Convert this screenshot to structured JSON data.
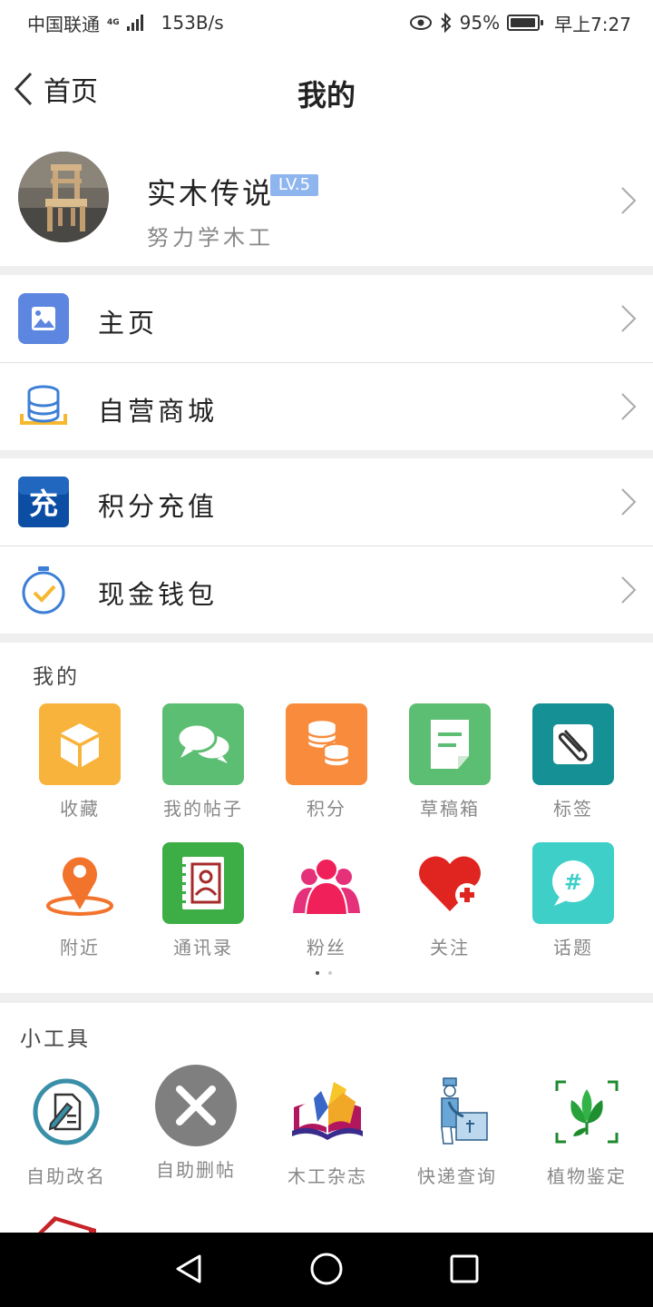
{
  "status_bar": {
    "carrier": "中国联通",
    "network": "4G",
    "speed": "153B/s",
    "battery": "95%",
    "battery_level": 0.95,
    "time": "早上7:27"
  },
  "header": {
    "back_label": "首页",
    "title": "我的"
  },
  "profile": {
    "name": "实木传说",
    "level": "LV.5",
    "signature": "努力学木工"
  },
  "menu": [
    {
      "label": "主页",
      "icon": "image-icon"
    },
    {
      "label": "自营商城",
      "icon": "coin-stack-icon"
    },
    {
      "label": "积分充值",
      "icon": "recharge-icon"
    },
    {
      "label": "现金钱包",
      "icon": "stopwatch-check-icon"
    }
  ],
  "mine": {
    "title": "我的",
    "items": [
      {
        "label": "收藏",
        "icon": "box-icon",
        "color": "#f8b33c"
      },
      {
        "label": "我的帖子",
        "icon": "chat-bubbles-icon",
        "color": "#5cbe72"
      },
      {
        "label": "积分",
        "icon": "coins-icon",
        "color": "#f88b3c"
      },
      {
        "label": "草稿箱",
        "icon": "draft-icon",
        "color": "#5cbe72"
      },
      {
        "label": "标签",
        "icon": "paperclip-icon",
        "color": "#159094"
      },
      {
        "label": "附近",
        "icon": "location-pin-icon",
        "color": "#f2732c"
      },
      {
        "label": "通讯录",
        "icon": "contacts-book-icon",
        "color": "#3dae46"
      },
      {
        "label": "粉丝",
        "icon": "people-icon",
        "color": "#e5307a"
      },
      {
        "label": "关注",
        "icon": "heart-plus-icon",
        "color": "#e0241f"
      },
      {
        "label": "话题",
        "icon": "hashtag-bubble-icon",
        "color": "#3ecfc8"
      }
    ]
  },
  "tools": {
    "title": "小工具",
    "items": [
      {
        "label": "自助改名",
        "icon": "edit-document-icon"
      },
      {
        "label": "自助删帖",
        "icon": "delete-circle-icon"
      },
      {
        "label": "木工杂志",
        "icon": "open-book-icon"
      },
      {
        "label": "快递查询",
        "icon": "delivery-icon"
      },
      {
        "label": "植物鉴定",
        "icon": "plant-scan-icon"
      }
    ]
  }
}
